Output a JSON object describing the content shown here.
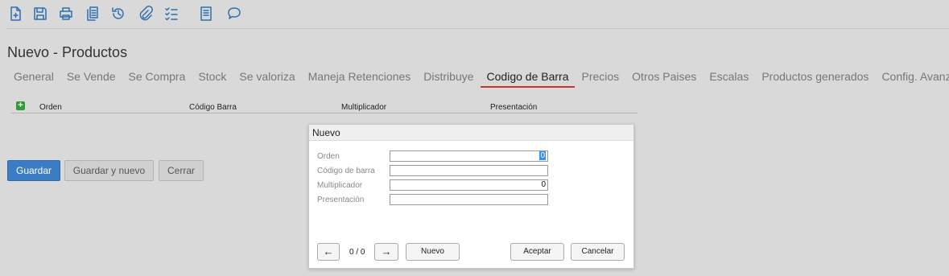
{
  "toolbar": {
    "icons": [
      "new-document-icon",
      "save-icon",
      "print-icon",
      "copy-icon",
      "history-icon",
      "attachment-icon",
      "checklist-icon",
      "report-icon",
      "comment-icon"
    ]
  },
  "page": {
    "title": "Nuevo - Productos"
  },
  "tabs": [
    {
      "label": "General"
    },
    {
      "label": "Se Vende"
    },
    {
      "label": "Se Compra"
    },
    {
      "label": "Stock"
    },
    {
      "label": "Se valoriza"
    },
    {
      "label": "Maneja Retenciones"
    },
    {
      "label": "Distribuye"
    },
    {
      "label": "Codigo de Barra",
      "active": true
    },
    {
      "label": "Precios"
    },
    {
      "label": "Otros Paises"
    },
    {
      "label": "Escalas"
    },
    {
      "label": "Productos generados"
    },
    {
      "label": "Config. Avanzada"
    }
  ],
  "grid": {
    "add_label": "+",
    "columns": [
      "Orden",
      "Código Barra",
      "Multiplicador",
      "Presentación"
    ]
  },
  "form_buttons": {
    "save": "Guardar",
    "save_new": "Guardar y nuevo",
    "close": "Cerrar"
  },
  "dialog": {
    "title": "Nuevo",
    "fields": [
      {
        "label": "Orden",
        "value": "0"
      },
      {
        "label": "Código de barra",
        "value": ""
      },
      {
        "label": "Multiplicador",
        "value": "0"
      },
      {
        "label": "Presentación",
        "value": ""
      }
    ],
    "prev_symbol": "←",
    "next_symbol": "→",
    "pager": "0 / 0",
    "new_label": "Nuevo",
    "accept_label": "Aceptar",
    "cancel_label": "Cancelar"
  },
  "colors": {
    "accent": "#3b7dc4",
    "active_tab_underline": "#c0392b",
    "add_icon": "#2e9c3a"
  }
}
